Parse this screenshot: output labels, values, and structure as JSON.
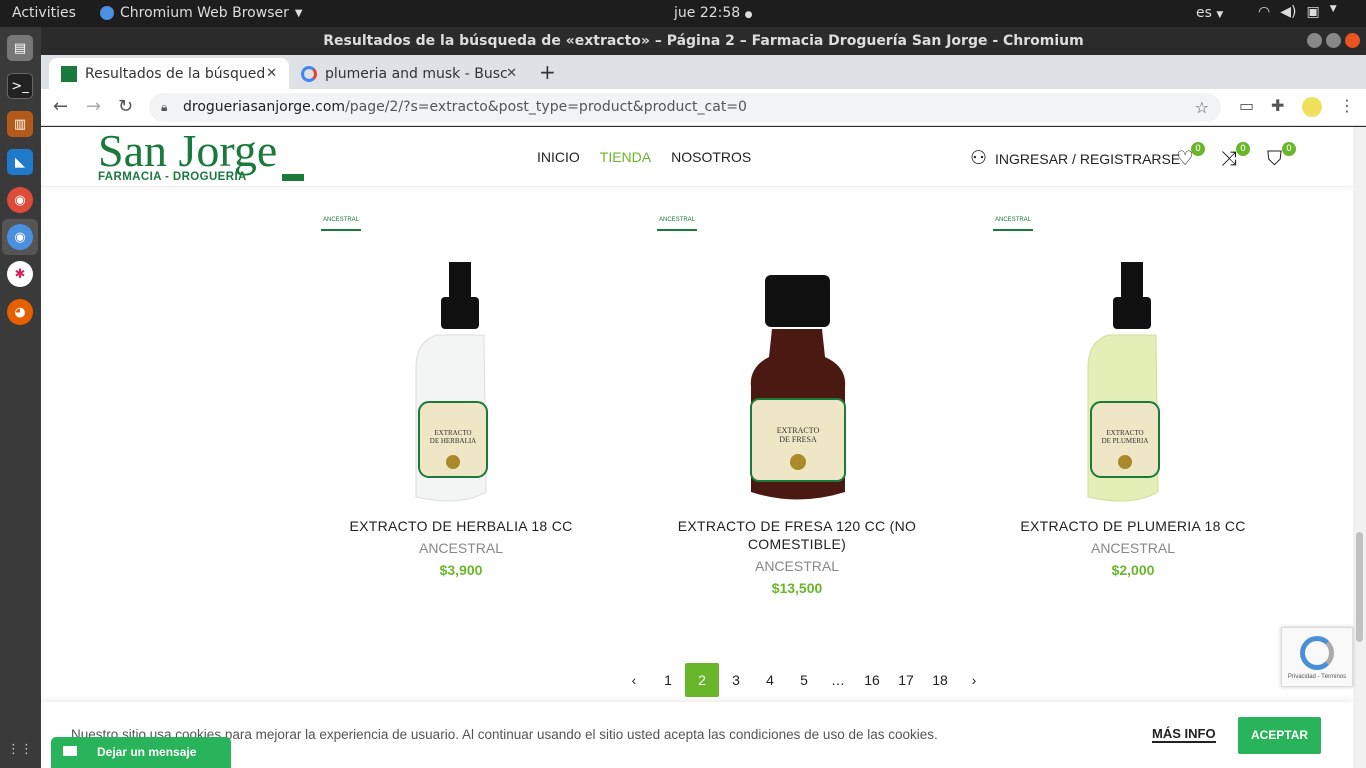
{
  "system": {
    "activities": "Activities",
    "app_name": "Chromium Web Browser",
    "clock": "jue 22:58",
    "lang": "es"
  },
  "window": {
    "title": "Resultados de la búsqueda de «extracto» – Página 2 – Farmacia Droguería San Jorge - Chromium"
  },
  "tabs": [
    {
      "label": "Resultados de la búsqued"
    },
    {
      "label": "plumeria and musk - Busc"
    }
  ],
  "omnibox": {
    "host": "drogueriasanjorge.com",
    "path": "/page/2/?s=extracto&post_type=product&product_cat=0"
  },
  "site": {
    "logo_name": "San Jorge",
    "logo_sub": "FARMACIA - DROGUERIA",
    "nav": [
      "INICIO",
      "TIENDA",
      "NOSOTROS"
    ],
    "account": "INGRESAR / REGISTRARSE",
    "wishlist_count": "0",
    "compare_count": "0",
    "cart_count": "0"
  },
  "products": [
    {
      "name": "EXTRACTO DE HERBALIA 18 CC",
      "brand": "ANCESTRAL",
      "price": "$3,900",
      "bottle_color": "#f3f4f4",
      "label": "EXTRACTO DE HERBALIA",
      "volume": "18 ml"
    },
    {
      "name": "EXTRACTO DE FRESA 120 CC (NO COMESTIBLE)",
      "brand": "ANCESTRAL",
      "price": "$13,500",
      "bottle_color": "#4a1a12",
      "label": "EXTRACTO DE FRESA",
      "volume": "120 ml"
    },
    {
      "name": "EXTRACTO DE PLUMERIA 18 CC",
      "brand": "ANCESTRAL",
      "price": "$2,000",
      "bottle_color": "#e4efb6",
      "label": "EXTRACTO DE PLUMERIA",
      "volume": "18 ml"
    }
  ],
  "brand_tag": "ANCESTRAL",
  "pagination": {
    "pages": [
      "1",
      "2",
      "3",
      "4",
      "5",
      "…",
      "16",
      "17",
      "18"
    ],
    "current": "2"
  },
  "cookie": {
    "message": "Nuestro sitio usa cookies para mejorar la experiencia de usuario. Al continuar usando el sitio usted acepta las condiciones de uso de las cookies.",
    "more": "MÁS INFO",
    "accept": "ACEPTAR"
  },
  "chat": {
    "label": "Dejar un mensaje"
  },
  "recaptcha": {
    "text": "Privacidad - Términos"
  },
  "colors": {
    "brand_green": "#1a7a3c",
    "accent_green": "#6ab62b",
    "button_green": "#29b35a"
  }
}
